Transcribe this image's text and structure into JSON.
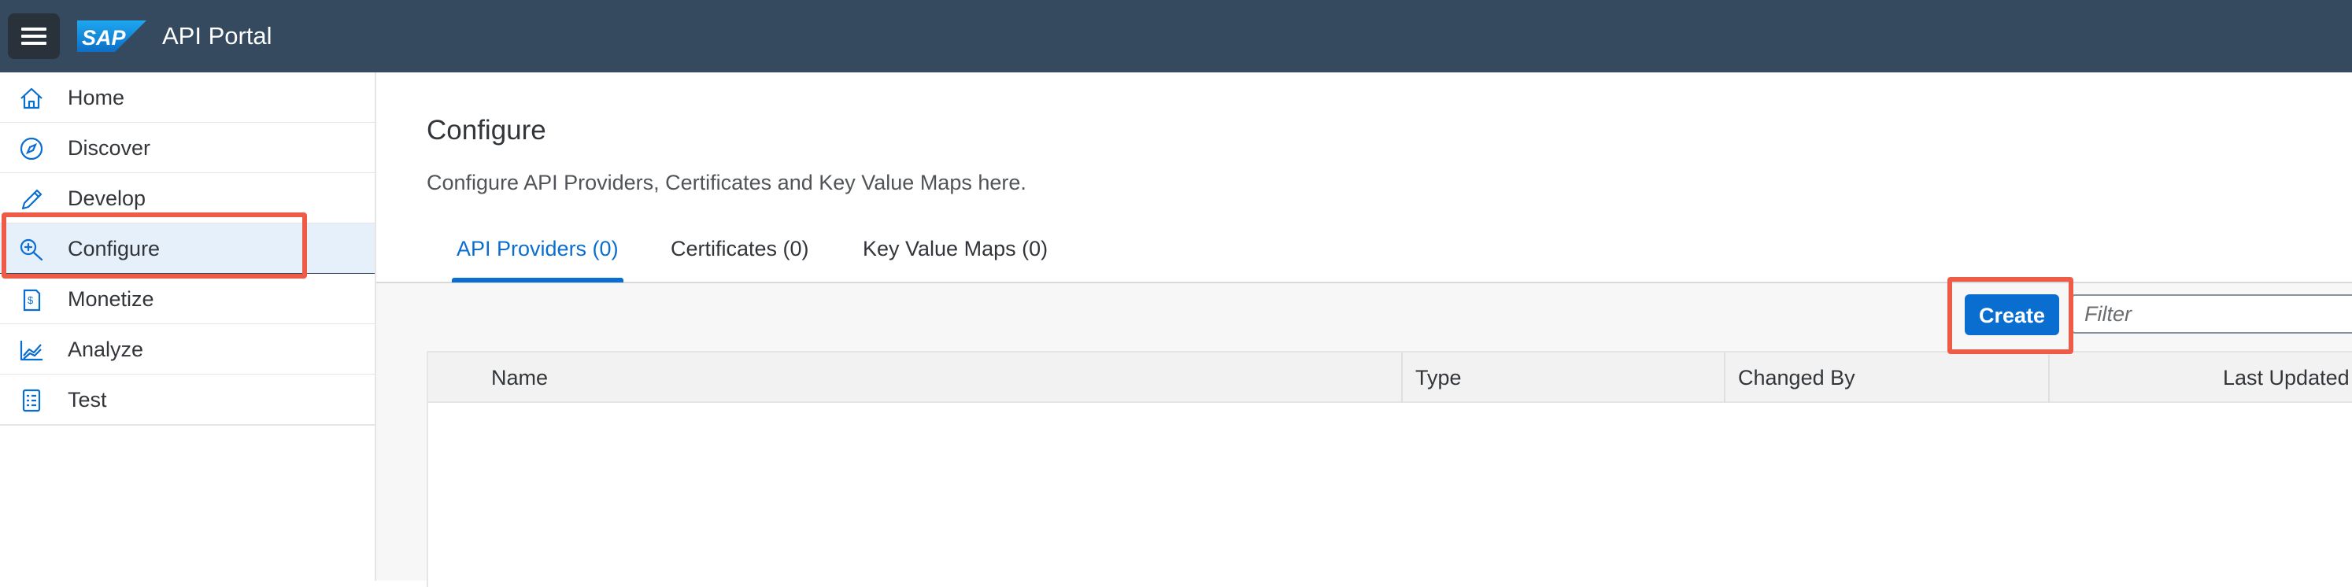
{
  "header": {
    "logo_text": "SAP",
    "title": "API Portal",
    "menu_icon": "hamburger-icon",
    "brand_color": "#354a5f"
  },
  "sidebar": {
    "items": [
      {
        "label": "Home",
        "icon": "home-icon"
      },
      {
        "label": "Discover",
        "icon": "compass-icon"
      },
      {
        "label": "Develop",
        "icon": "pencil-icon"
      },
      {
        "label": "Configure",
        "icon": "configure-icon",
        "selected": true
      },
      {
        "label": "Monetize",
        "icon": "monetize-icon"
      },
      {
        "label": "Analyze",
        "icon": "analyze-icon"
      },
      {
        "label": "Test",
        "icon": "test-icon"
      }
    ]
  },
  "main": {
    "title": "Configure",
    "description": "Configure API Providers, Certificates and Key Value Maps here.",
    "tabs": [
      {
        "label": "API Providers (0)",
        "selected": true
      },
      {
        "label": "Certificates (0)"
      },
      {
        "label": "Key Value Maps (0)"
      }
    ],
    "toolbar": {
      "create_label": "Create",
      "filter_placeholder": "Filter"
    },
    "table": {
      "columns": [
        "Name",
        "Type",
        "Changed By",
        "Last Updated"
      ],
      "rows": []
    }
  },
  "colors": {
    "accent": "#0a6ed1",
    "highlight": "#ee5b47",
    "selected_nav_bg": "#e5f0fa"
  }
}
